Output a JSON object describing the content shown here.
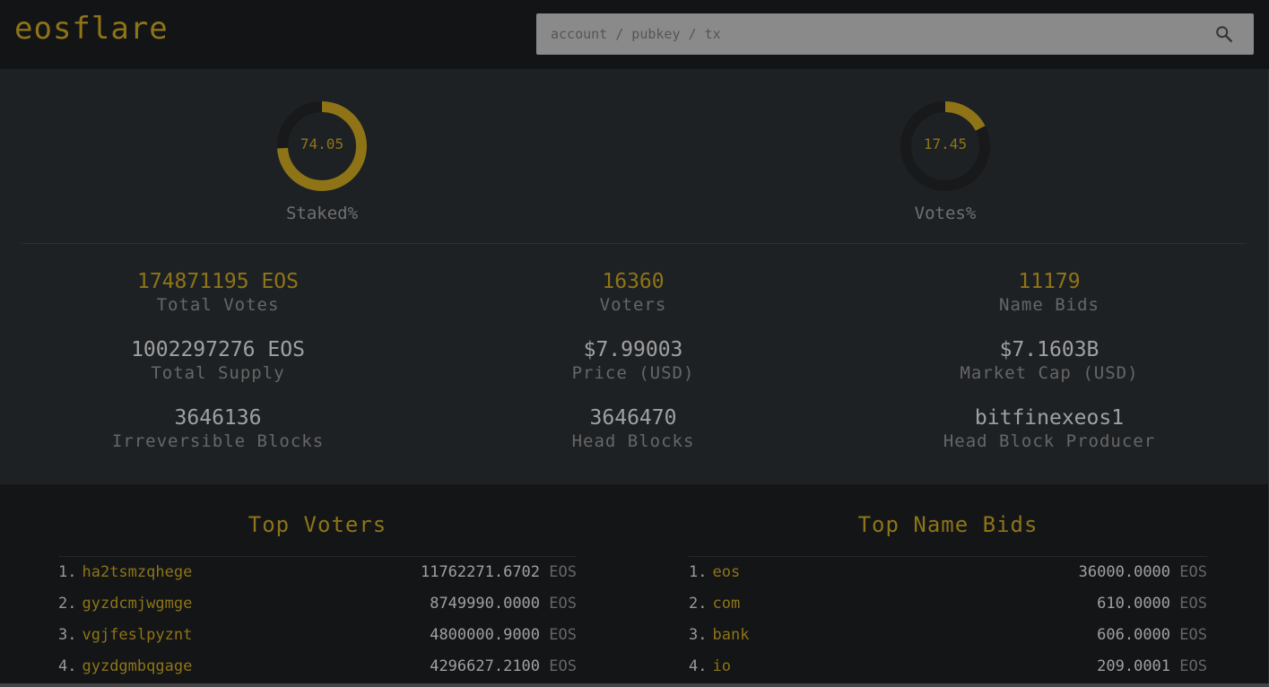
{
  "app": {
    "logo": "eosflare"
  },
  "search": {
    "placeholder": "account / pubkey / tx"
  },
  "gauges": [
    {
      "value": "74.05",
      "label": "Staked%",
      "fraction": 0.7405
    },
    {
      "value": "17.45",
      "label": "Votes%",
      "fraction": 0.1745
    }
  ],
  "stats": {
    "total_votes": {
      "value": "174871195 EOS",
      "label": "Total Votes"
    },
    "voters": {
      "value": "16360",
      "label": "Voters"
    },
    "name_bids": {
      "value": "11179",
      "label": "Name Bids"
    },
    "total_supply": {
      "value": "1002297276 EOS",
      "label": "Total Supply"
    },
    "price": {
      "value": "$7.99003",
      "label": "Price (USD)"
    },
    "market_cap": {
      "value": "$7.1603B",
      "label": "Market Cap (USD)"
    },
    "irreversible": {
      "value": "3646136",
      "label": "Irreversible Blocks"
    },
    "head_blocks": {
      "value": "3646470",
      "label": "Head Blocks"
    },
    "producer": {
      "value": "bitfinexeos1",
      "label": "Head Block Producer"
    }
  },
  "top_voters": {
    "title": "Top Voters",
    "rows": [
      {
        "rank": "1.",
        "name": "ha2tsmzqhege",
        "amount": "11762271.6702",
        "unit": "EOS"
      },
      {
        "rank": "2.",
        "name": "gyzdcmjwgmge",
        "amount": "8749990.0000",
        "unit": "EOS"
      },
      {
        "rank": "3.",
        "name": "vgjfeslpyznt",
        "amount": "4800000.9000",
        "unit": "EOS"
      },
      {
        "rank": "4.",
        "name": "gyzdgmbqgage",
        "amount": "4296627.2100",
        "unit": "EOS"
      }
    ]
  },
  "top_name_bids": {
    "title": "Top Name Bids",
    "rows": [
      {
        "rank": "1.",
        "name": "eos",
        "amount": "36000.0000",
        "unit": "EOS"
      },
      {
        "rank": "2.",
        "name": "com",
        "amount": "610.0000",
        "unit": "EOS"
      },
      {
        "rank": "3.",
        "name": "bank",
        "amount": "606.0000",
        "unit": "EOS"
      },
      {
        "rank": "4.",
        "name": "io",
        "amount": "209.0001",
        "unit": "EOS"
      }
    ]
  },
  "colors": {
    "accent": "#8e7417",
    "gauge_track": "#17191b"
  }
}
